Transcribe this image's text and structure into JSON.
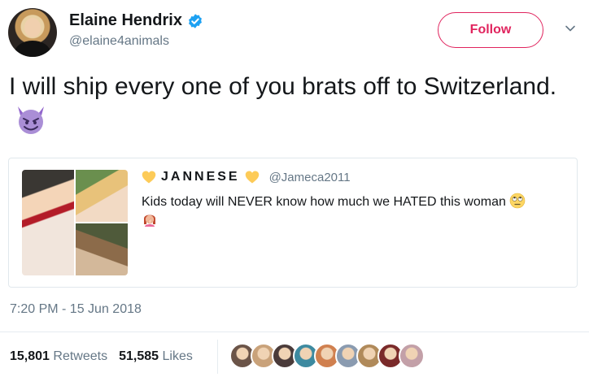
{
  "author": {
    "display_name": "Elaine Hendrix",
    "handle": "@elaine4animals",
    "verified": true,
    "avatar_icon": "avatar"
  },
  "actions": {
    "follow_label": "Follow",
    "menu_icon": "chevron-down-icon"
  },
  "tweet": {
    "text": "I will ship every one of you brats off to Switzerland.",
    "emoji": "smiling-devil-icon"
  },
  "quoted_tweet": {
    "display_name": "JANNESE",
    "handle": "@Jameca2011",
    "name_decoration": "yellow-heart-icon",
    "text": "Kids today will NEVER know how much we HATED this woman",
    "emojis": [
      "eye-roll-icon",
      "facepalm-icon"
    ],
    "media_count": 3
  },
  "timestamp": "7:20 PM - 15 Jun 2018",
  "stats": {
    "retweets_count": "15,801",
    "retweets_label": "Retweets",
    "likes_count": "51,585",
    "likes_label": "Likes"
  },
  "likers": [
    "#6b5448",
    "#c9a27a",
    "#4a3b3a",
    "#3d8aa0",
    "#d0804f",
    "#8a9bb0",
    "#b08a5a",
    "#7a2a2a",
    "#c3a0a8"
  ],
  "colors": {
    "follow_accent": "#e0245e",
    "verified_blue": "#1da1f2",
    "secondary_text": "#657786"
  }
}
